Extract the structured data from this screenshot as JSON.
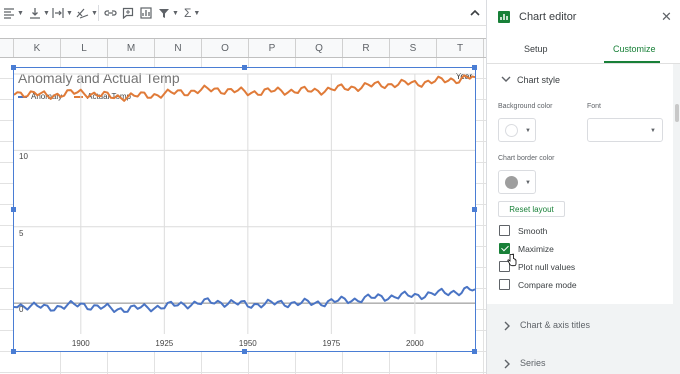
{
  "sheet": {
    "columns": [
      "K",
      "L",
      "M",
      "N",
      "O",
      "P",
      "Q",
      "R",
      "S",
      "T"
    ]
  },
  "toolbar": {
    "icons": [
      "align-left-icon",
      "vertical-align-icon",
      "text-wrap-icon",
      "text-rotate-icon",
      "link-icon",
      "comment-icon",
      "insert-chart-icon",
      "filter-icon",
      "functions-icon",
      "collapse-icon"
    ]
  },
  "chart_data": {
    "type": "line",
    "title": "Anomaly and Actual Temp",
    "x_axis_label": "Year",
    "x_ticks": [
      "1900",
      "1925",
      "1950",
      "1975",
      "2000"
    ],
    "y_ticks": [
      "0",
      "5",
      "10"
    ],
    "xlim": [
      1880,
      2018
    ],
    "ylim": [
      -1.5,
      15
    ],
    "legend_position": "top-left",
    "gridlines": true,
    "series": [
      {
        "name": "Anomaly",
        "color": "#4a74c4",
        "x": [
          1880,
          1890,
          1900,
          1910,
          1920,
          1930,
          1940,
          1950,
          1960,
          1970,
          1980,
          1990,
          2000,
          2010,
          2018
        ],
        "values": [
          -0.1,
          -0.3,
          -0.1,
          -0.4,
          -0.3,
          -0.1,
          0.1,
          -0.1,
          0.0,
          0.0,
          0.2,
          0.4,
          0.5,
          0.7,
          0.9
        ]
      },
      {
        "name": "Actual Temp",
        "color": "#e07b39",
        "x": [
          1880,
          1890,
          1900,
          1910,
          1920,
          1930,
          1940,
          1950,
          1960,
          1970,
          1980,
          1990,
          2000,
          2010,
          2018
        ],
        "values": [
          13.8,
          13.6,
          13.8,
          13.5,
          13.6,
          13.8,
          14.0,
          13.8,
          13.9,
          13.9,
          14.1,
          14.3,
          14.4,
          14.6,
          14.8
        ]
      }
    ]
  },
  "editor": {
    "title": "Chart editor",
    "tabs": {
      "setup": "Setup",
      "customize": "Customize"
    },
    "chart_style": {
      "title": "Chart style",
      "background_color_label": "Background color",
      "background_color": "#ffffff",
      "font_label": "Font",
      "font_value": "",
      "border_color_label": "Chart border color",
      "border_color": "#9e9e9e",
      "reset_label": "Reset layout",
      "options": [
        {
          "label": "Smooth",
          "checked": false
        },
        {
          "label": "Maximize",
          "checked": true
        },
        {
          "label": "Plot null values",
          "checked": false
        },
        {
          "label": "Compare mode",
          "checked": false
        }
      ]
    },
    "sections": [
      "Chart & axis titles",
      "Series"
    ]
  },
  "colors": {
    "accent": "#188038",
    "selection": "#4a7dd4"
  }
}
